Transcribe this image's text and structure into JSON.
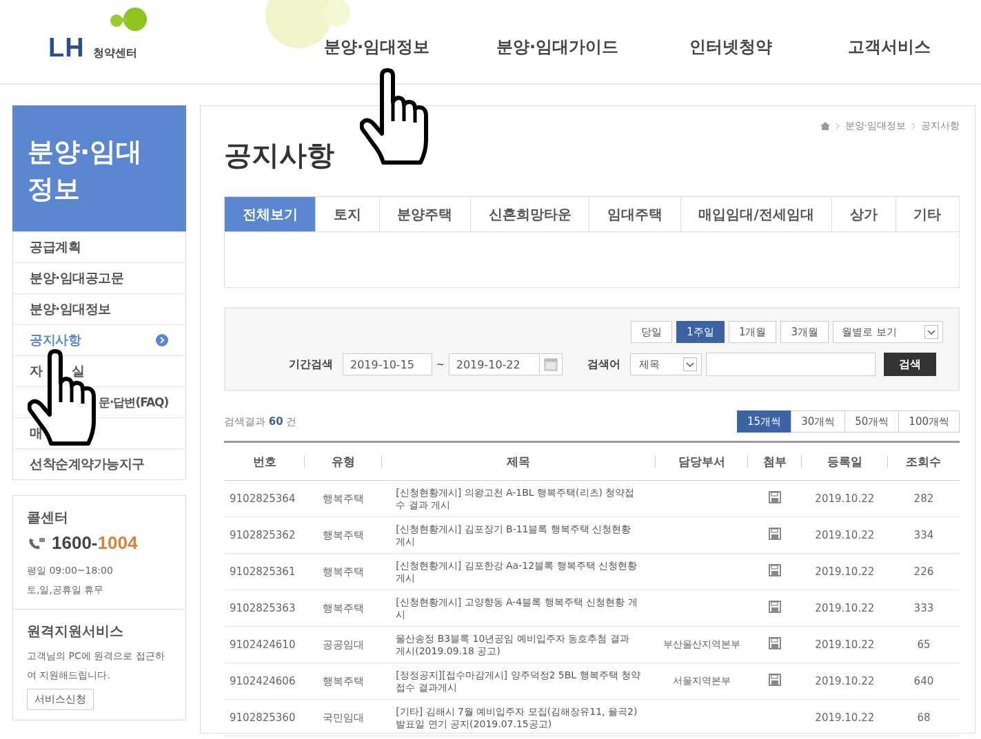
{
  "header": {
    "logo": {
      "mark": "LH",
      "subtitle": "청약센터"
    },
    "nav": [
      {
        "label": "분양·임대정보"
      },
      {
        "label": "분양·임대가이드"
      },
      {
        "label": "인터넷청약"
      },
      {
        "label": "고객서비스"
      }
    ]
  },
  "sidebar": {
    "title": "분양·임대 정보",
    "items": [
      {
        "label": "공급계획",
        "selected": false,
        "kind": "plain"
      },
      {
        "label": "분양·임대공고문",
        "selected": false,
        "kind": "plain"
      },
      {
        "label": "분양·임대정보",
        "selected": false,
        "kind": "plain"
      },
      {
        "label": "공지사항",
        "selected": true,
        "kind": "plain"
      },
      {
        "label": "자",
        "tail": "실",
        "selected": false,
        "kind": "split"
      },
      {
        "label": "문·답변(FAQ)",
        "selected": false,
        "kind": "tail"
      },
      {
        "label": "매",
        "selected": false,
        "kind": "plain"
      },
      {
        "label": "선착순계약가능지구",
        "selected": false,
        "kind": "plain"
      }
    ],
    "call_center": {
      "title": "콜센터",
      "number_prefix": "1600-",
      "number_suffix": "1004",
      "hours": "평일 09:00~18:00",
      "closed": "토,일,공휴일 휴무"
    },
    "remote_support": {
      "title": "원격지원서비스",
      "description": "고객님의 PC에 원격으로 접근하여 지원해드립니다.",
      "button": "서비스신청"
    }
  },
  "main": {
    "breadcrumb": [
      "분양·임대정보",
      "공지사항"
    ],
    "title": "공지사항",
    "tabs": [
      {
        "label": "전체보기",
        "selected": true
      },
      {
        "label": "토지",
        "selected": false
      },
      {
        "label": "분양주택",
        "selected": false
      },
      {
        "label": "신혼희망타운",
        "selected": false
      },
      {
        "label": "임대주택",
        "selected": false
      },
      {
        "label": "매입임대/전세임대",
        "selected": false
      },
      {
        "label": "상가",
        "selected": false
      },
      {
        "label": "기타",
        "selected": false
      }
    ],
    "search": {
      "periods": [
        {
          "label": "당일",
          "selected": false
        },
        {
          "label": "1주일",
          "selected": true
        },
        {
          "label": "1개월",
          "selected": false
        },
        {
          "label": "3개월",
          "selected": false
        }
      ],
      "month_select": "월별로 보기",
      "period_label": "기간검색",
      "date_from": "2019-10-15",
      "date_sep": "~",
      "date_to": "2019-10-22",
      "keyword_label": "검색어",
      "keyword_field": "제목",
      "button": "검색"
    },
    "result": {
      "prefix": "검색결과",
      "count": "60",
      "suffix": "건"
    },
    "page_sizes": [
      {
        "label": "15개씩",
        "selected": true
      },
      {
        "label": "30개씩",
        "selected": false
      },
      {
        "label": "50개씩",
        "selected": false
      },
      {
        "label": "100개씩",
        "selected": false
      }
    ],
    "table": {
      "columns": [
        "번호",
        "유형",
        "제목",
        "담당부서",
        "첨부",
        "등록일",
        "조회수"
      ],
      "rows": [
        {
          "number": "9102825364",
          "type": "행복주택",
          "title": "[신청현황게시] 의왕고천 A-1BL 행복주택(리츠) 청약접수 결과 게시",
          "attachment": true,
          "date": "2019.10.22",
          "views": "282"
        },
        {
          "number": "9102825362",
          "type": "행복주택",
          "title": "[신청현황게시] 김포장기 B-11블록 행복주택 신청현황 게시",
          "attachment": true,
          "date": "2019.10.22",
          "views": "334"
        },
        {
          "number": "9102825361",
          "type": "행복주택",
          "title": "[신청현황게시] 김포한강 Aa-12블록 행복주택 신청현황 게시",
          "attachment": true,
          "date": "2019.10.22",
          "views": "226"
        },
        {
          "number": "9102825363",
          "type": "행복주택",
          "title": "[신청현황게시] 고양향동 A-4블록 행복주택 신청현황 게시",
          "attachment": true,
          "date": "2019.10.22",
          "views": "333"
        },
        {
          "number": "9102424610",
          "type": "공공임대",
          "title": "울산송정 B3블록 10년공임 예비입주자 동호추첨 결과 게시(2019.09.18 공고)",
          "department": "부산울산지역본부",
          "attachment": true,
          "date": "2019.10.22",
          "views": "65"
        },
        {
          "number": "9102424606",
          "type": "행복주택",
          "title": "[정정공지][접수마감게시] 양주덕정2 5BL 행복주택 청약접수 결과게시",
          "department": "서울지역본부",
          "attachment": true,
          "date": "2019.10.22",
          "views": "640"
        },
        {
          "number": "9102825360",
          "type": "국민임대",
          "title": "[기타] 김해시 7월 예비입주자 모집(김해장유11, 율곡2) 발표일 연기 공지(2019.07.15공고)",
          "attachment": false,
          "date": "2019.10.22",
          "views": "68"
        }
      ]
    }
  },
  "cursors": [
    {
      "kind": "hand"
    },
    {
      "kind": "hand"
    }
  ]
}
